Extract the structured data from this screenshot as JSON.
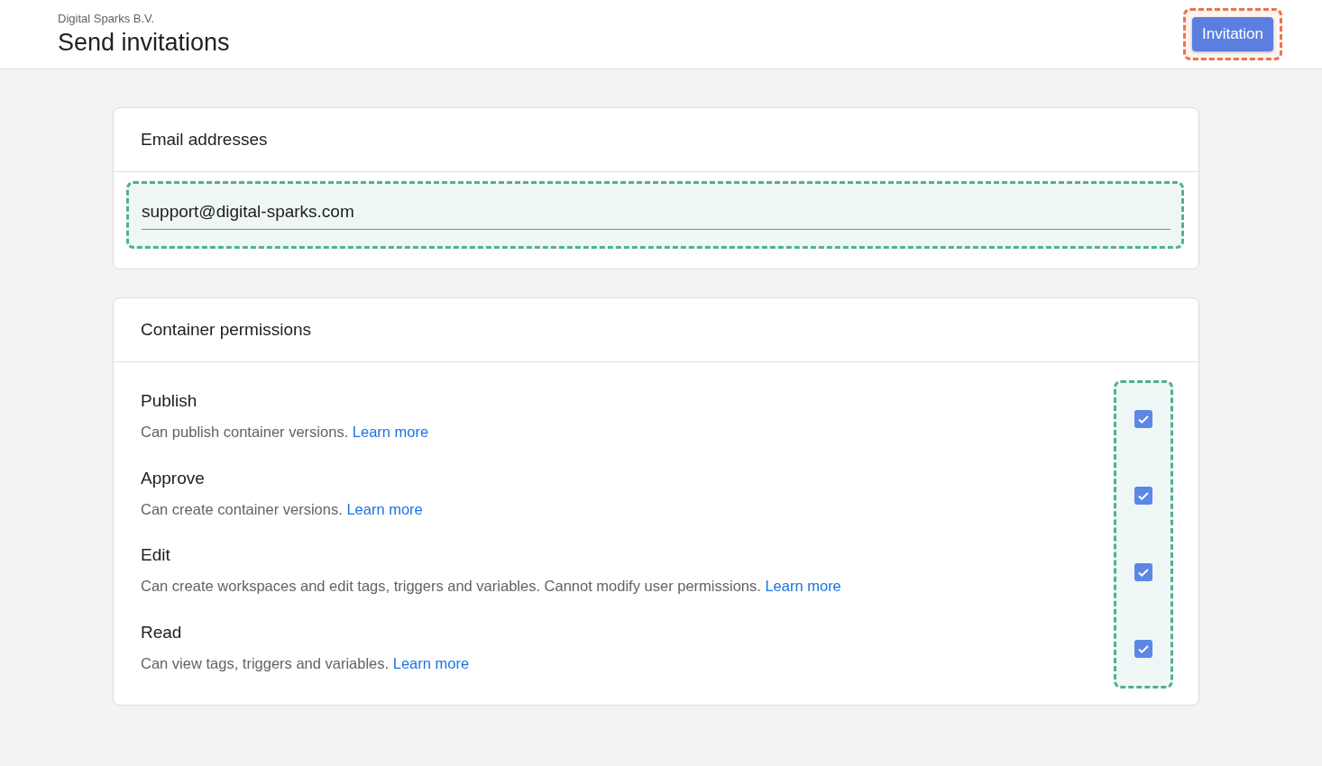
{
  "header": {
    "organization": "Digital Sparks B.V.",
    "title": "Send invitations",
    "button": "Invitation"
  },
  "email_card": {
    "title": "Email addresses",
    "value": "support@digital-sparks.com"
  },
  "permissions_card": {
    "title": "Container permissions",
    "items": [
      {
        "name": "Publish",
        "description": "Can publish container versions.",
        "link": "Learn more",
        "checked": true
      },
      {
        "name": "Approve",
        "description": "Can create container versions.",
        "link": "Learn more",
        "checked": true
      },
      {
        "name": "Edit",
        "description": "Can create workspaces and edit tags, triggers and variables. Cannot modify user permissions.",
        "link": "Learn more",
        "checked": true
      },
      {
        "name": "Read",
        "description": "Can view tags, triggers and variables.",
        "link": "Learn more",
        "checked": true
      }
    ]
  }
}
